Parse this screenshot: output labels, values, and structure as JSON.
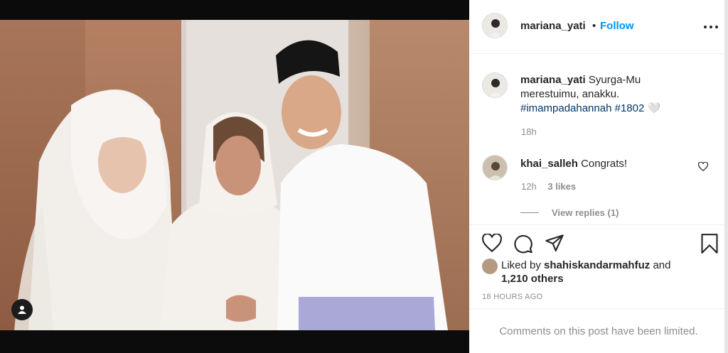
{
  "header": {
    "username": "mariana_yati",
    "separator": "•",
    "follow_label": "Follow",
    "more_icon": "more-horizontal-icon"
  },
  "caption": {
    "username": "mariana_yati",
    "text_line": "Syurga-Mu merestuimu, anakku.",
    "hashtags": "#imampadahannah #1802",
    "emoji": "🤍",
    "time": "18h"
  },
  "comment": {
    "username": "khai_salleh",
    "text": "Congrats!",
    "time": "12h",
    "likes": "3 likes",
    "view_replies": "View replies (1)"
  },
  "actions": {
    "like_icon": "heart-icon",
    "comment_icon": "comment-icon",
    "share_icon": "send-icon",
    "save_icon": "bookmark-icon"
  },
  "likes": {
    "prefix": "Liked by",
    "user": "shahiskandarmahfuz",
    "conj": "and",
    "others": "1,210 others"
  },
  "post_age": "18 HOURS AGO",
  "comments_limited": "Comments on this post have been limited.",
  "colors": {
    "link_blue": "#0095f6",
    "hashtag": "#00376b",
    "muted": "#8e8e8e",
    "text": "#262626"
  }
}
